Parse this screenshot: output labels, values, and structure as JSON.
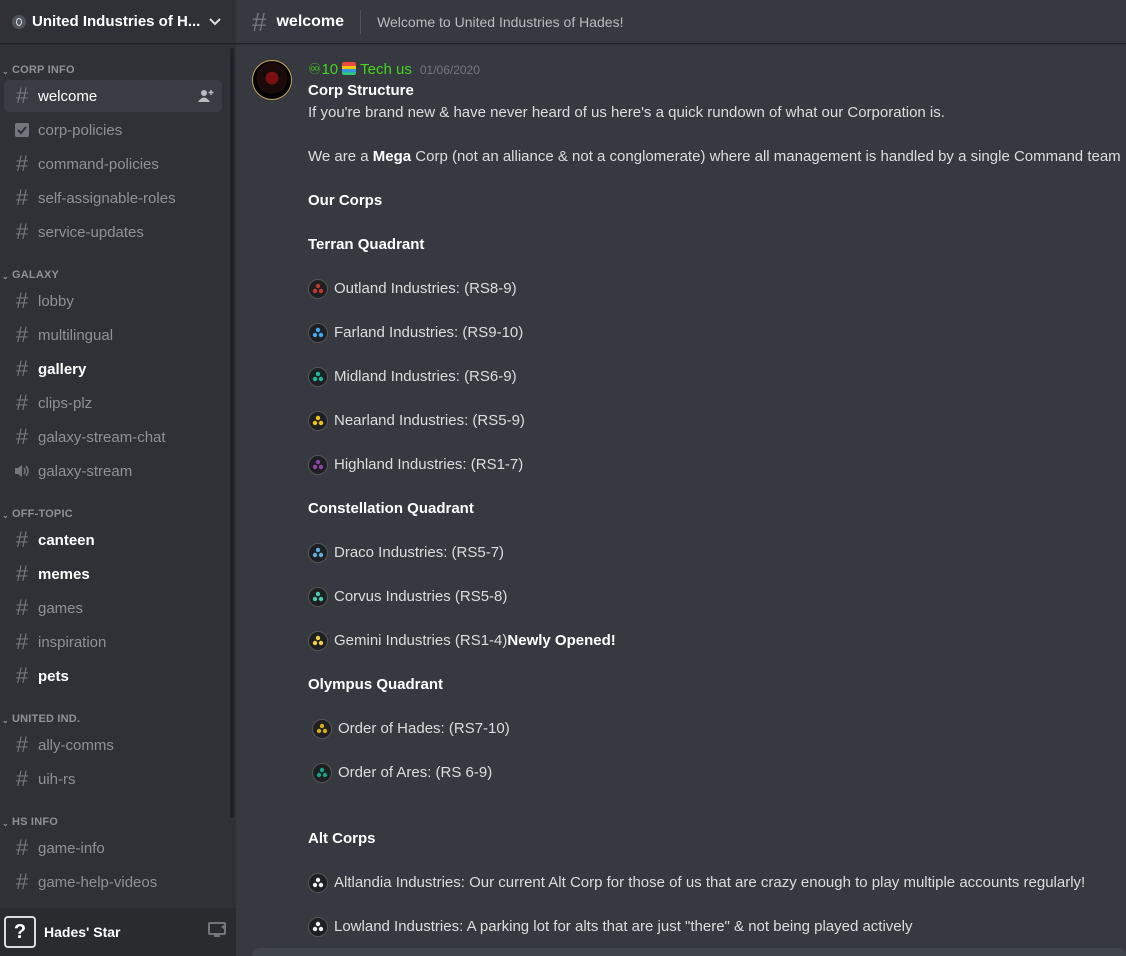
{
  "guild": {
    "name": "United Industries of H..."
  },
  "sidebar": {
    "categories": [
      {
        "name": "CORP INFO",
        "channels": [
          {
            "name": "welcome",
            "icon": "hash-icon",
            "state": "active"
          },
          {
            "name": "corp-policies",
            "icon": "checkbox-icon",
            "state": "normal"
          },
          {
            "name": "command-policies",
            "icon": "hash-icon",
            "state": "normal"
          },
          {
            "name": "self-assignable-roles",
            "icon": "hash-icon",
            "state": "normal"
          },
          {
            "name": "service-updates",
            "icon": "hash-icon",
            "state": "normal"
          }
        ]
      },
      {
        "name": "GALAXY",
        "channels": [
          {
            "name": "lobby",
            "icon": "hash-icon",
            "state": "normal"
          },
          {
            "name": "multilingual",
            "icon": "hash-icon",
            "state": "normal"
          },
          {
            "name": "gallery",
            "icon": "hash-icon",
            "state": "unread"
          },
          {
            "name": "clips-plz",
            "icon": "hash-icon",
            "state": "normal"
          },
          {
            "name": "galaxy-stream-chat",
            "icon": "hash-icon",
            "state": "normal"
          },
          {
            "name": "galaxy-stream",
            "icon": "speaker-icon",
            "state": "normal"
          }
        ]
      },
      {
        "name": "OFF-TOPIC",
        "channels": [
          {
            "name": "canteen",
            "icon": "hash-icon",
            "state": "unread"
          },
          {
            "name": "memes",
            "icon": "hash-icon",
            "state": "unread"
          },
          {
            "name": "games",
            "icon": "hash-icon",
            "state": "normal"
          },
          {
            "name": "inspiration",
            "icon": "hash-icon",
            "state": "normal"
          },
          {
            "name": "pets",
            "icon": "hash-icon",
            "state": "unread"
          }
        ]
      },
      {
        "name": "UNITED IND.",
        "channels": [
          {
            "name": "ally-comms",
            "icon": "hash-icon",
            "state": "normal"
          },
          {
            "name": "uih-rs",
            "icon": "hash-icon",
            "state": "normal"
          }
        ]
      },
      {
        "name": "HS INFO",
        "channels": [
          {
            "name": "game-info",
            "icon": "hash-icon",
            "state": "normal"
          },
          {
            "name": "game-help-videos",
            "icon": "hash-icon",
            "state": "normal"
          }
        ]
      }
    ]
  },
  "user_panel": {
    "name": "Hades' Star",
    "avatar_text": "?"
  },
  "channel_header": {
    "name": "welcome",
    "topic": "Welcome to United Industries of Hades!"
  },
  "message": {
    "author_prefix": "♾10",
    "author": "Tech us",
    "timestamp": "01/06/2020",
    "lines": [
      {
        "type": "bold",
        "text": "Corp Structure"
      },
      {
        "type": "text",
        "text": "If you're brand new & have never heard of us here's a quick rundown of what our Corporation is."
      },
      {
        "type": "gap"
      },
      {
        "type": "mixed",
        "parts": [
          "We are a ",
          "Mega",
          " Corp (not an alliance & not a conglomerate) where all management is handled by a single Command team"
        ]
      },
      {
        "type": "gap"
      },
      {
        "type": "bold",
        "text": "Our Corps"
      },
      {
        "type": "gap"
      },
      {
        "type": "bold",
        "text": "Terran Quadrant"
      },
      {
        "type": "gap"
      },
      {
        "type": "corp",
        "text": "Outland Industries: (RS8-9)",
        "color": "#c0392b"
      },
      {
        "type": "gap"
      },
      {
        "type": "corp",
        "text": "Farland Industries: (RS9-10)",
        "color": "#3fa9f5"
      },
      {
        "type": "gap"
      },
      {
        "type": "corp",
        "text": "Midland Industries: (RS6-9)",
        "color": "#1abc9c"
      },
      {
        "type": "gap"
      },
      {
        "type": "corp",
        "text": "Nearland Industries: (RS5-9)",
        "color": "#f1c40f"
      },
      {
        "type": "gap"
      },
      {
        "type": "corp",
        "text": "Highland Industries: (RS1-7)",
        "color": "#8e44ad"
      },
      {
        "type": "gap"
      },
      {
        "type": "bold",
        "text": "Constellation Quadrant"
      },
      {
        "type": "gap"
      },
      {
        "type": "corp",
        "text": "Draco Industries: (RS5-7)",
        "color": "#5dade2"
      },
      {
        "type": "gap"
      },
      {
        "type": "corp",
        "text": "Corvus Industries (RS5-8)",
        "color": "#48c9b0"
      },
      {
        "type": "gap"
      },
      {
        "type": "corp_bold",
        "text": "Gemini Industries (RS1-4) ",
        "bold": "Newly Opened!",
        "color": "#f4d03f"
      },
      {
        "type": "gap"
      },
      {
        "type": "bold",
        "text": "Olympus Quadrant"
      },
      {
        "type": "gap"
      },
      {
        "type": "corp_indent",
        "text": "Order of Hades: (RS7-10)",
        "color": "#d4ac0d"
      },
      {
        "type": "gap"
      },
      {
        "type": "corp_indent",
        "text": "Order of Ares: (RS 6-9)",
        "color": "#16a085"
      },
      {
        "type": "gap"
      },
      {
        "type": "gap"
      },
      {
        "type": "bold",
        "text": "Alt Corps"
      },
      {
        "type": "gap"
      },
      {
        "type": "corp",
        "text": "Altlandia Industries: Our current Alt Corp for those of us that are crazy enough to play multiple accounts regularly!",
        "color": "#ecf0f1"
      },
      {
        "type": "gap"
      },
      {
        "type": "corp",
        "text": "Lowland Industries: A parking lot for alts that are just \"there\" & not being played actively",
        "color": "#ecf0f1"
      }
    ]
  },
  "colors": {
    "author": "#43d41c",
    "background": "#36393f",
    "sidebar": "#2f3136"
  }
}
